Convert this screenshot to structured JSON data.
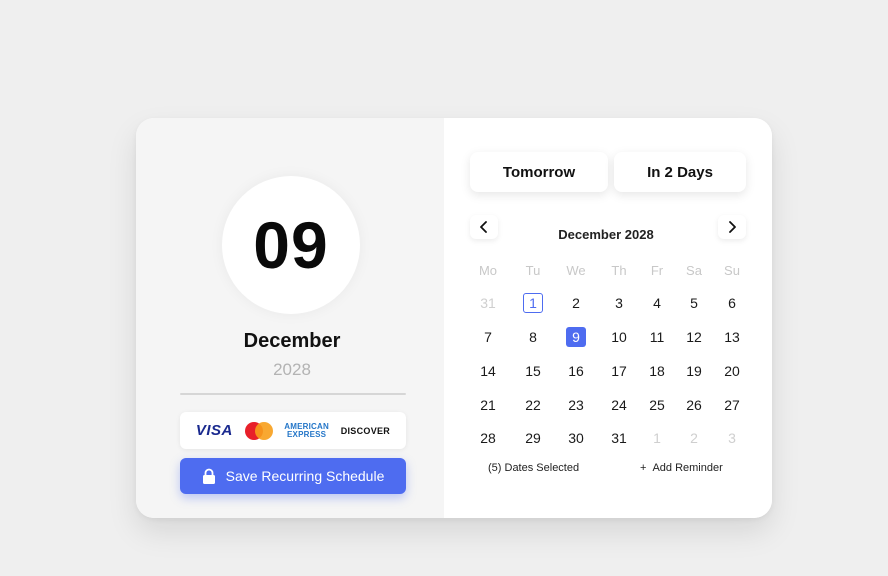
{
  "date_display": {
    "day": "09",
    "month": "December",
    "year": "2028"
  },
  "payment_logos": [
    "visa-logo",
    "mastercard-logo",
    "amex-logo",
    "discover-logo"
  ],
  "payment_logo_text": {
    "visa": "VISA",
    "amex_line1": "AMERICAN",
    "amex_line2": "EXPRESS",
    "discover": "DISCOVER"
  },
  "save_button": {
    "label": "Save Recurring Schedule",
    "icon": "lock-icon"
  },
  "quick_select": {
    "tomorrow": "Tomorrow",
    "in_2_days": "In 2 Days"
  },
  "calendar": {
    "title": "December 2028",
    "prev_icon": "chevron-left-icon",
    "next_icon": "chevron-right-icon",
    "weekdays": [
      "Mo",
      "Tu",
      "We",
      "Th",
      "Fr",
      "Sa",
      "Su"
    ],
    "weeks": [
      [
        "31",
        "1",
        "2",
        "3",
        "4",
        "5",
        "6"
      ],
      [
        "7",
        "8",
        "9",
        "10",
        "11",
        "12",
        "13"
      ],
      [
        "14",
        "15",
        "16",
        "17",
        "18",
        "19",
        "20"
      ],
      [
        "21",
        "22",
        "23",
        "24",
        "25",
        "26",
        "27"
      ],
      [
        "28",
        "29",
        "30",
        "31",
        "1",
        "2",
        "3"
      ]
    ],
    "today_day": "1",
    "selected_day": "9"
  },
  "footer": {
    "dates_selected": "(5) Dates Selected",
    "add_reminder": "Add Reminder",
    "add_reminder_icon": "plus-icon"
  },
  "colors": {
    "accent": "#4e6cf0",
    "muted_text": "#cfcfcf",
    "panel_left": "#f5f5f5"
  }
}
